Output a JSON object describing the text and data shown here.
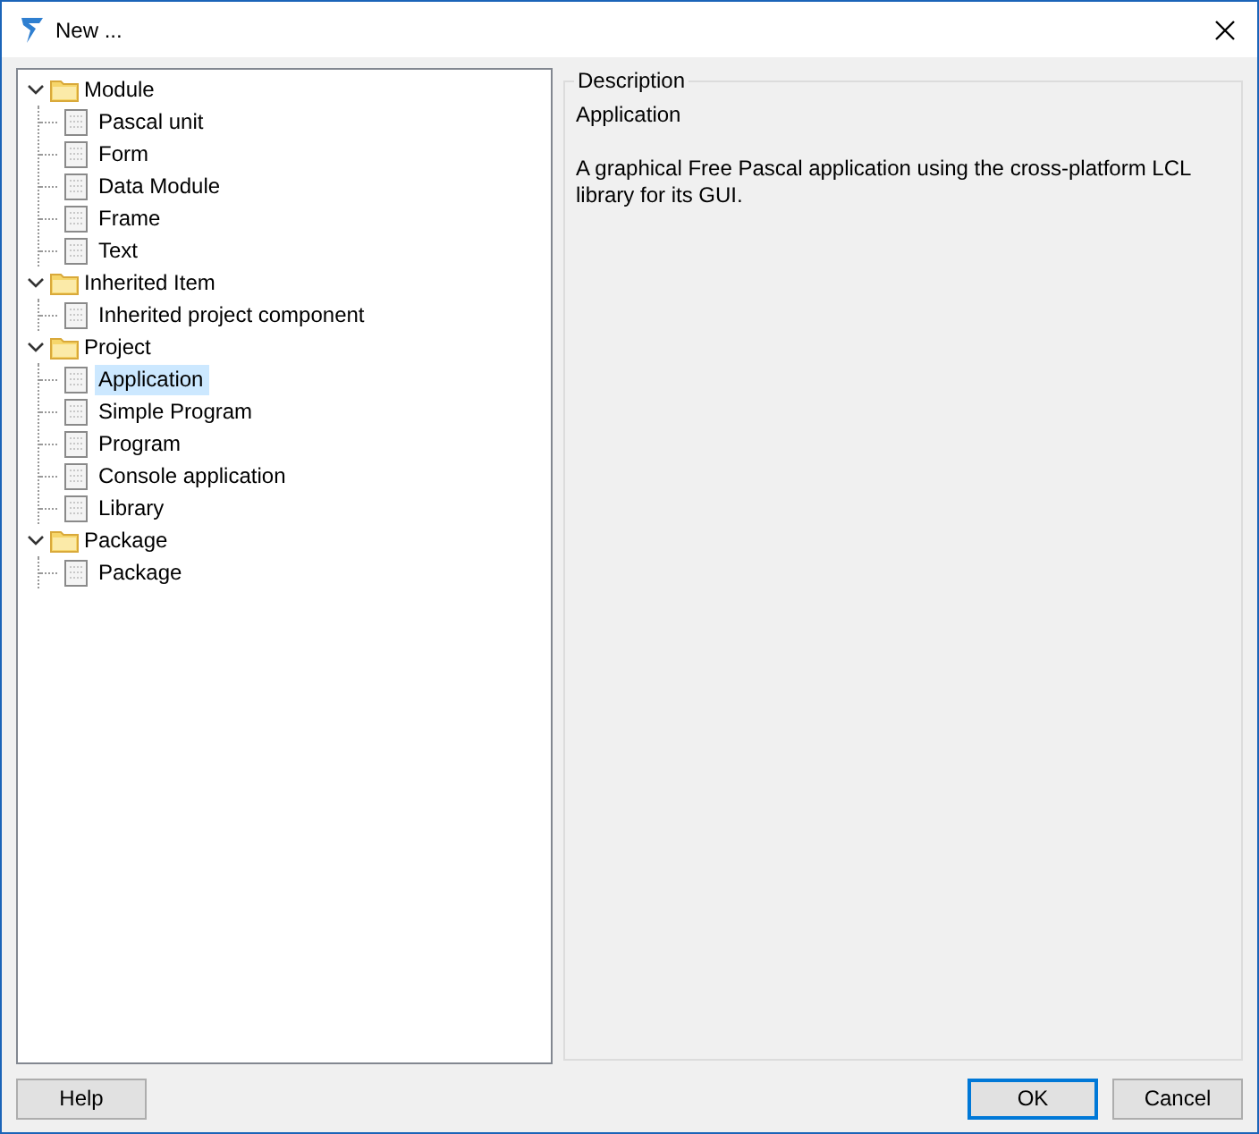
{
  "window": {
    "title": "New ..."
  },
  "tree": [
    {
      "label": "Module",
      "expanded": true,
      "children": [
        {
          "label": "Pascal unit",
          "selected": false
        },
        {
          "label": "Form",
          "selected": false
        },
        {
          "label": "Data Module",
          "selected": false
        },
        {
          "label": "Frame",
          "selected": false
        },
        {
          "label": "Text",
          "selected": false
        }
      ]
    },
    {
      "label": "Inherited Item",
      "expanded": true,
      "children": [
        {
          "label": "Inherited project component",
          "selected": false
        }
      ]
    },
    {
      "label": "Project",
      "expanded": true,
      "children": [
        {
          "label": "Application",
          "selected": true
        },
        {
          "label": "Simple Program",
          "selected": false
        },
        {
          "label": "Program",
          "selected": false
        },
        {
          "label": "Console application",
          "selected": false
        },
        {
          "label": "Library",
          "selected": false
        }
      ]
    },
    {
      "label": "Package",
      "expanded": true,
      "children": [
        {
          "label": "Package",
          "selected": false
        }
      ]
    }
  ],
  "description": {
    "caption": "Description",
    "title": "Application",
    "text": "A graphical Free Pascal application using the cross-platform LCL library for its GUI."
  },
  "buttons": [
    {
      "label": "Help",
      "kind": "left",
      "default": false
    },
    {
      "label": "OK",
      "kind": "right",
      "default": true
    },
    {
      "label": "Cancel",
      "kind": "right",
      "default": false
    }
  ]
}
